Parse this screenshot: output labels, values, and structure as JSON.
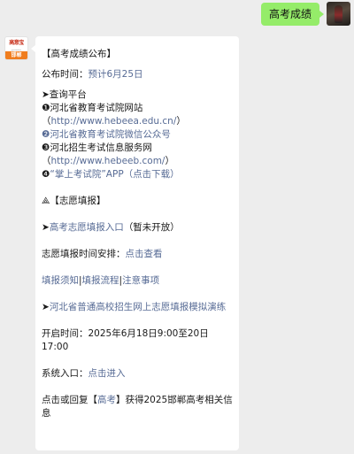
{
  "outgoing": {
    "text": "高考成绩"
  },
  "account": {
    "logo_top": "高意宝",
    "logo_sub": "gaokaobao",
    "logo_bottom": "邯郸"
  },
  "msg": {
    "heading": "【高考成绩公布】",
    "publish_label": "公布时间：",
    "publish_value": "预计6月25日",
    "query_title": "➤查询平台",
    "item1_prefix": "❶河北省教育考试院网站（",
    "item1_url": "http://www.hebeea.edu.cn/",
    "item1_suffix": "）",
    "item2": "❷河北省教育考试院微信公众号",
    "item3_prefix": "❸河北招生考试信息服务网（",
    "item3_url": "http://www.hebeeb.com/",
    "item3_suffix": "）",
    "item4_bullet": "❹",
    "item4_text": "“掌上考试院”APP（点击下载）",
    "volunteer_title": "⟁【志愿填报】",
    "entry_arrow": "➤",
    "entry_link": "高考志愿填报入口",
    "entry_note": "（暂未开放）",
    "schedule_label": "志愿填报时间安排：",
    "schedule_link": "点击查看",
    "notice_link1": "填报须知",
    "notice_sep1": "|",
    "notice_link2": "填报流程",
    "notice_sep2": "|",
    "notice_link3": "注意事项",
    "sim_arrow": "➤",
    "sim_link": "河北省普通高校招生网上志愿填报模拟演练",
    "open_time": "开启时间：2025年6月18日9:00至20日17:00",
    "system_label": "系统入口：",
    "system_link": "点击进入",
    "reply_prefix": "点击或回复【",
    "reply_link": "高考",
    "reply_suffix": "】获得2025邯郸高考相关信息"
  },
  "colors": {
    "link": "#576b95",
    "outgoing_bubble": "#95ec69",
    "background": "#ededed"
  }
}
